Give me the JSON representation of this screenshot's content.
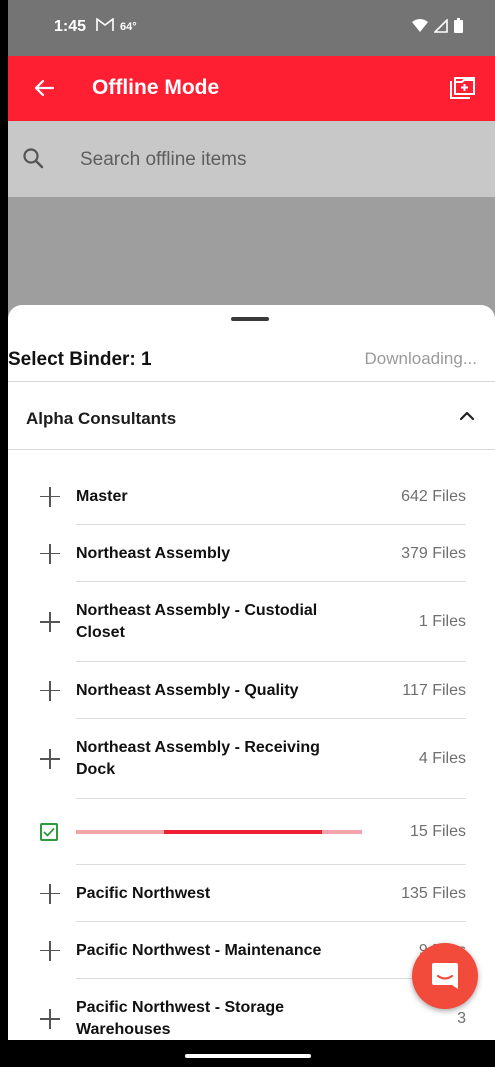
{
  "status_bar": {
    "time": "1:45",
    "temperature": "64°",
    "mail_icon": "gmail-icon"
  },
  "app_bar": {
    "title": "Offline Mode",
    "back_icon": "arrow-left-icon",
    "action_icon": "folder-add-icon",
    "color": "#ff1f33"
  },
  "search": {
    "placeholder": "Search offline items"
  },
  "sheet": {
    "title": "Select Binder: 1",
    "status": "Downloading...",
    "group": {
      "name": "Alpha Consultants",
      "expanded": true
    }
  },
  "items": [
    {
      "name": "Master",
      "count": "642 Files",
      "state": "add"
    },
    {
      "name": "Northeast Assembly",
      "count": "379 Files",
      "state": "add"
    },
    {
      "name": "Northeast Assembly - Custodial Closet",
      "count": "1 Files",
      "state": "add"
    },
    {
      "name": "Northeast Assembly - Quality",
      "count": "117 Files",
      "state": "add"
    },
    {
      "name": "Northeast Assembly - Receiving Dock",
      "count": "4 Files",
      "state": "add"
    },
    {
      "name": "",
      "count": "15 Files",
      "state": "downloading"
    },
    {
      "name": "Pacific Northwest",
      "count": "135 Files",
      "state": "add"
    },
    {
      "name": "Pacific Northwest - Maintenance",
      "count": "9 Files",
      "state": "add"
    },
    {
      "name": "Pacific Northwest - Storage Warehouses",
      "count": "3",
      "state": "add"
    }
  ],
  "colors": {
    "accent": "#ff1f33",
    "check": "#2f9a3c",
    "progress_track": "#f3a3aa"
  }
}
